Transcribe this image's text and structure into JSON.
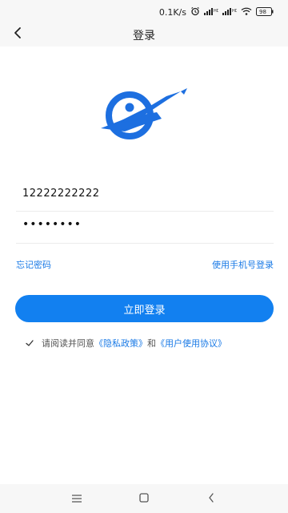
{
  "status_bar": {
    "network_speed": "0.1K/s",
    "battery": "98",
    "icons": [
      "alarm-icon",
      "signal-icon",
      "signal-icon",
      "wifi-icon",
      "battery-icon"
    ]
  },
  "header": {
    "title": "登录",
    "back_icon": "chevron-left-icon"
  },
  "form": {
    "username_value": "12222222222",
    "password_value": "••••••••"
  },
  "links": {
    "forgot_password": "忘记密码",
    "phone_login": "使用手机号登录"
  },
  "login_button_label": "立即登录",
  "agreement": {
    "checked": true,
    "prefix": "请阅读并同意",
    "privacy_policy": "《隐私政策》",
    "and": "和",
    "user_agreement": "《用户使用协议》"
  },
  "nav_bar": {
    "icons": [
      "menu-icon",
      "home-icon",
      "back-icon"
    ]
  },
  "colors": {
    "accent": "#1280f0",
    "link": "#1a7ae6",
    "logo": "#1d6fe0"
  }
}
